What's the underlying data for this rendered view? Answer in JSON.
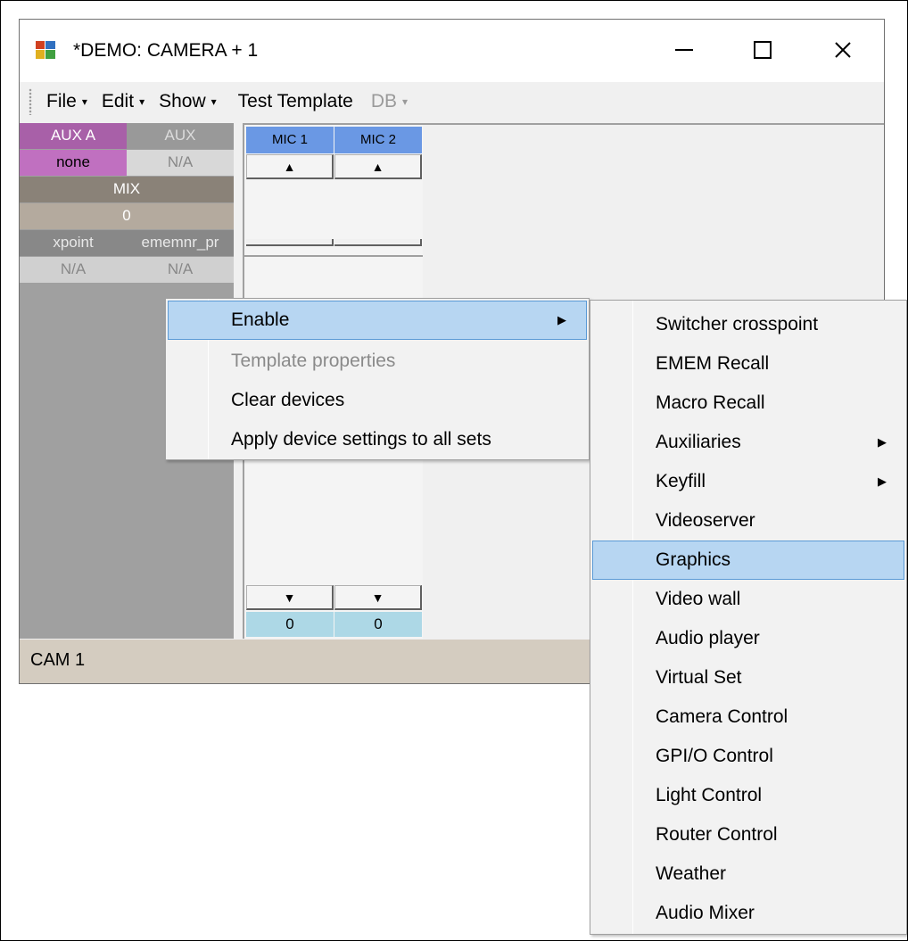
{
  "window": {
    "title": "*DEMO: CAMERA + 1",
    "controls": {
      "minimize": "—",
      "maximize": "☐",
      "close": "✕"
    }
  },
  "menubar": {
    "items": [
      {
        "label": "File",
        "has_dropdown": true,
        "enabled": true
      },
      {
        "label": "Edit",
        "has_dropdown": true,
        "enabled": true
      },
      {
        "label": "Show",
        "has_dropdown": true,
        "enabled": true
      },
      {
        "label": "Test Template",
        "has_dropdown": false,
        "enabled": true
      },
      {
        "label": "DB",
        "has_dropdown": true,
        "enabled": false
      }
    ],
    "caret": "▾"
  },
  "left_panel": {
    "aux_a": {
      "header": "AUX A",
      "value": "none"
    },
    "aux": {
      "header": "AUX",
      "value": "N/A"
    },
    "mix": {
      "header": "MIX",
      "value": "0"
    },
    "xpoint": {
      "header": "xpoint",
      "value": "N/A"
    },
    "ememnr": {
      "header": "ememnr_pr",
      "value": "N/A"
    }
  },
  "mics": [
    {
      "label": "MIC 1",
      "up": "▲",
      "down": "▼",
      "value": "0"
    },
    {
      "label": "MIC 2",
      "up": "▲",
      "down": "▼",
      "value": "0"
    }
  ],
  "statusbar": {
    "text": "CAM 1"
  },
  "context_menu": {
    "items": [
      {
        "label": "Enable",
        "highlighted": true,
        "has_submenu": true,
        "enabled": true
      },
      {
        "label": "Template properties",
        "highlighted": false,
        "has_submenu": false,
        "enabled": false
      },
      {
        "label": "Clear devices",
        "highlighted": false,
        "has_submenu": false,
        "enabled": true
      },
      {
        "label": "Apply device settings to all sets",
        "highlighted": false,
        "has_submenu": false,
        "enabled": true
      }
    ],
    "submenu_arrow": "▶"
  },
  "enable_submenu": {
    "items": [
      {
        "label": "Switcher crosspoint",
        "has_submenu": false,
        "highlighted": false
      },
      {
        "label": "EMEM Recall",
        "has_submenu": false,
        "highlighted": false
      },
      {
        "label": "Macro Recall",
        "has_submenu": false,
        "highlighted": false
      },
      {
        "label": "Auxiliaries",
        "has_submenu": true,
        "highlighted": false
      },
      {
        "label": "Keyfill",
        "has_submenu": true,
        "highlighted": false
      },
      {
        "label": "Videoserver",
        "has_submenu": false,
        "highlighted": false
      },
      {
        "label": "Graphics",
        "has_submenu": false,
        "highlighted": true
      },
      {
        "label": "Video wall",
        "has_submenu": false,
        "highlighted": false
      },
      {
        "label": "Audio player",
        "has_submenu": false,
        "highlighted": false
      },
      {
        "label": "Virtual Set",
        "has_submenu": false,
        "highlighted": false
      },
      {
        "label": "Camera Control",
        "has_submenu": false,
        "highlighted": false
      },
      {
        "label": "GPI/O Control",
        "has_submenu": false,
        "highlighted": false
      },
      {
        "label": "Light Control",
        "has_submenu": false,
        "highlighted": false
      },
      {
        "label": "Router Control",
        "has_submenu": false,
        "highlighted": false
      },
      {
        "label": "Weather",
        "has_submenu": false,
        "highlighted": false
      },
      {
        "label": "Audio Mixer",
        "has_submenu": false,
        "highlighted": false
      }
    ]
  },
  "colors": {
    "menu_highlight": "#b7d6f2",
    "menu_highlight_border": "#5a9ad6",
    "aux_a": "#a860a8",
    "mic_header": "#6a98e4",
    "mic_value": "#add8e6",
    "statusbar": "#d4ccc0"
  }
}
